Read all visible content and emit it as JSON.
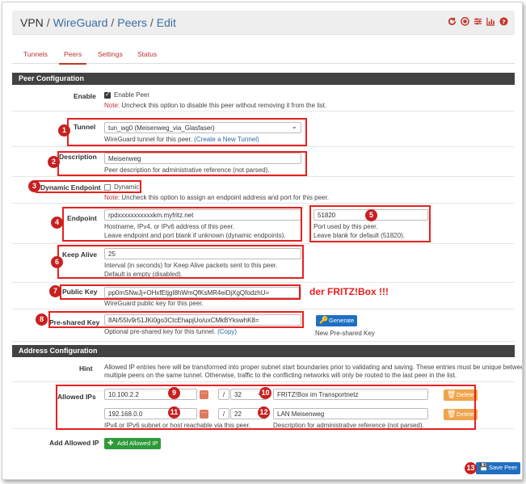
{
  "breadcrumb": {
    "vpn": "VPN",
    "wireguard": "WireGuard",
    "peers": "Peers",
    "edit": "Edit",
    "sep": "/"
  },
  "header_icons": [
    "reload-icon",
    "stop-circle-icon",
    "sliders-icon",
    "bar-chart-icon",
    "help-icon"
  ],
  "tabs": [
    {
      "label": "Tunnels"
    },
    {
      "label": "Peers"
    },
    {
      "label": "Settings"
    },
    {
      "label": "Status"
    }
  ],
  "peer_config": {
    "heading": "Peer Configuration",
    "enable": {
      "label": "Enable",
      "checkbox_label": "Enable Peer",
      "note_prefix": "Note:",
      "note": " Uncheck this option to disable this peer without removing it from the list.",
      "checked": true
    },
    "tunnel": {
      "label": "Tunnel",
      "value": "tun_wg0 (Meisenweg_via_Glasfaser)",
      "help": "WireGuard tunnel for this peer. ",
      "help_link": "(Create a New Tunnel)"
    },
    "description": {
      "label": "Description",
      "value": "Meisenweg",
      "help": "Peer description for administrative reference (not parsed)."
    },
    "dynamic_endpoint": {
      "label": "Dynamic Endpoint",
      "checkbox_label": "Dynamic",
      "note_prefix": "Note:",
      "note": " Uncheck this option to assign an endpoint address and port for this peer.",
      "checked": false
    },
    "endpoint": {
      "label": "Endpoint",
      "value": "rpdxxxxxxxxxxxkm.myfritz.net",
      "help1": "Hostname, IPv4, or IPv6 address of this peer.",
      "help2": "Leave endpoint and port blank if unknown (dynamic endpoints).",
      "port_value": "51820",
      "port_help1": "Port used by this peer.",
      "port_help2": "Leave blank for default (51820)."
    },
    "keep_alive": {
      "label": "Keep Alive",
      "value": "25",
      "help1": "Interval (in seconds) for Keep Alive packets sent to this peer.",
      "help2": "Default is empty (disabled)."
    },
    "public_key": {
      "label": "Public Key",
      "value": "pp0mSNwJj+OHxfEtjgI8hWmQfKsMR4eiDjXgQfodzhU=",
      "help": "WireGuard public key for this peer.",
      "annotation": "der FRITZ!Box !!!"
    },
    "preshared_key": {
      "label": "Pre-shared Key",
      "value": "8Al/55lv9r51JKi0go3CtcEhapjUo/uxCMkBYkswhK8=",
      "help": "Optional pre-shared key for this tunnel. ",
      "help_link": "(Copy)",
      "generate_label": "Generate",
      "generate_caption": "New Pre-shared Key"
    }
  },
  "address_config": {
    "heading": "Address Configuration",
    "hint_label": "Hint",
    "hint_text1": "Allowed IP entries here will be transformed into proper subnet start boundaries prior to validating and saving. These entries must be unique between",
    "hint_text2": "multiple peers on the same tunnel. Otherwise, traffic to the conflicting networks will only be routed to the last peer in the list.",
    "allowed_ips_label": "Allowed IPs",
    "entries": [
      {
        "ip": "10.100.2.2",
        "cidr": "32",
        "desc": "FRITZ!Box im Transportnetz",
        "delete_label": "Delete"
      },
      {
        "ip": "192.168.0.0",
        "cidr": "22",
        "desc": "LAN Meisenweg",
        "delete_label": "Delete"
      }
    ],
    "slash": "/",
    "ip_help": "IPv4 or IPv6 subnet or host reachable via this peer.",
    "desc_help": "Description for administrative reference (not parsed).",
    "add_label": "Add Allowed IP",
    "add_button": "Add Allowed IP"
  },
  "save_button": "Save Peer",
  "badges": [
    "1",
    "2",
    "3",
    "4",
    "5",
    "6",
    "7",
    "8",
    "9",
    "10",
    "11",
    "12",
    "13"
  ],
  "colors": {
    "accent_red": "#e8201f",
    "link": "#2a6aa8",
    "header_bg": "#424242",
    "save_blue": "#1e6fc2"
  }
}
